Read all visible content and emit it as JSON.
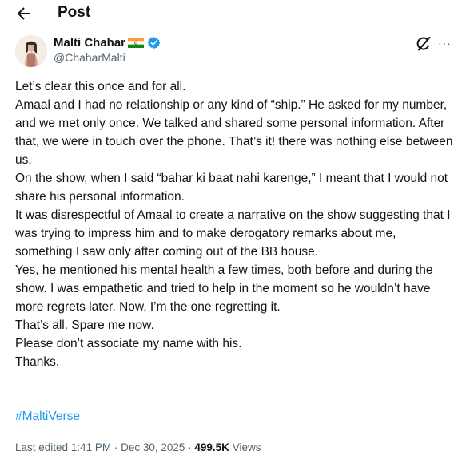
{
  "header": {
    "title": "Post",
    "back_icon": "arrow-left-icon"
  },
  "author": {
    "name": "Malti Chahar",
    "flag_icon": "india-flag-icon",
    "verified_icon": "verified-badge-icon",
    "handle": "@ChaharMalti"
  },
  "actions": {
    "grok_icon": "grok-icon",
    "more_label": "···"
  },
  "tweet": {
    "text": "Let’s clear this once and for all.\nAmaal and I had no relationship or any kind of “ship.” He asked for my number, and we met only once. We talked and shared some personal information. After that, we were in touch over the phone. That’s it! there was nothing else between us.\nOn the show, when I said “bahar ki baat nahi karenge,” I meant that I would not share his personal information.\nIt was disrespectful of Amaal to create a narrative on the show suggesting that I was trying to impress him and to make derogatory remarks about me, something I saw only after coming out of the BB house.\nYes, he mentioned his mental health a few times, both before and during the show. I was empathetic and tried to help in the moment so he wouldn’t have more regrets later. Now, I’m the one regretting it.\nThat’s all. Spare me now.\nPlease don’t associate my name with his.\nThanks.",
    "hashtag": "#MaltiVerse"
  },
  "meta": {
    "edited": "Last edited 1:41 PM · Dec 30, 2025 · ",
    "views_count": "499.5K",
    "views_label": " Views"
  },
  "colors": {
    "text": "#0f1419",
    "secondary": "#536471",
    "accent": "#1d9bf0"
  }
}
